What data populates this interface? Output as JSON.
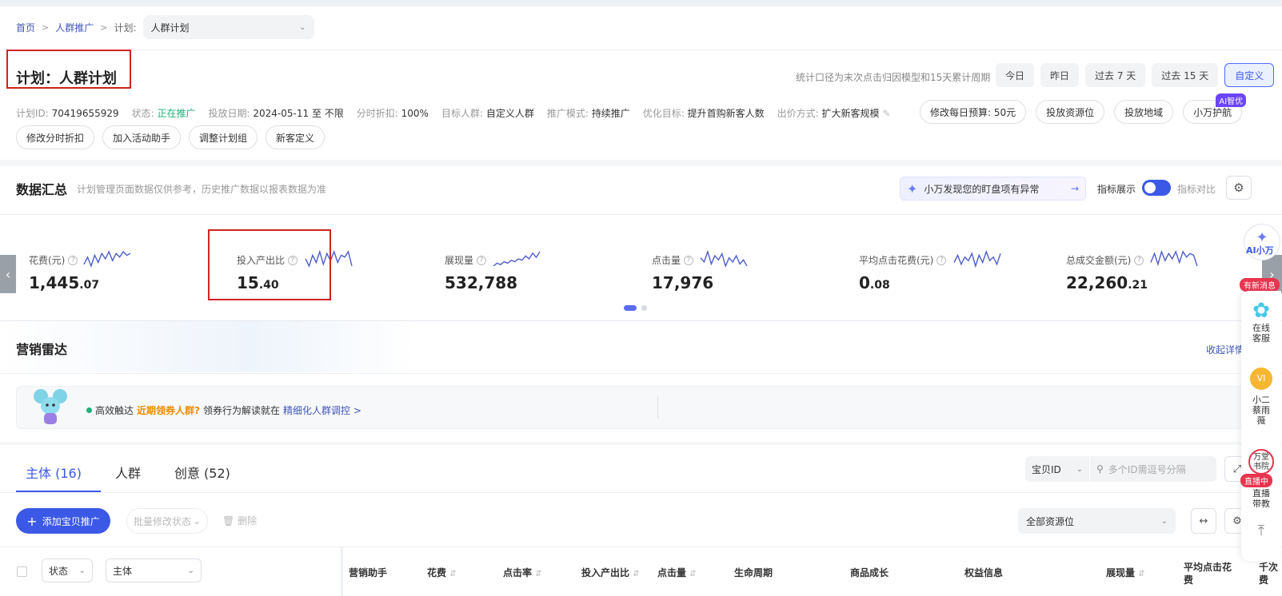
{
  "breadcrumb": {
    "home": "首页",
    "section": "人群推广",
    "plan_label": "计划:",
    "plan_select": "人群计划"
  },
  "title": "计划：人群计划",
  "stat_note": "统计口径为末次点击归因模型和15天累计周期",
  "date_ranges": [
    "今日",
    "昨日",
    "过去 7 天",
    "过去 15 天",
    "自定义"
  ],
  "meta": [
    {
      "k": "计划ID:",
      "v": "70419655929"
    },
    {
      "k": "状态:",
      "v": "正在推广"
    },
    {
      "k": "投放日期:",
      "v": "2024-05-11 至 不限"
    },
    {
      "k": "分时折扣:",
      "v": "100%"
    },
    {
      "k": "目标人群:",
      "v": "自定义人群"
    },
    {
      "k": "推广模式:",
      "v": "持续推广"
    },
    {
      "k": "优化目标:",
      "v": "提升首购新客人数"
    },
    {
      "k": "出价方式:",
      "v": "扩大新客规模"
    }
  ],
  "action_pills": [
    "修改每日预算: 50元",
    "投放资源位",
    "投放地域",
    "小万护航"
  ],
  "ai_badge": "AI智优",
  "action_pills_row2": [
    "修改分时折扣",
    "加入活动助手",
    "调整计划组",
    "新客定义"
  ],
  "summary": {
    "title": "数据汇总",
    "note": "计划管理页面数据仅供参考，历史推广数据以报表数据为准",
    "anomaly": "小万发现您的盯盘项有异常",
    "metric_display": "指标展示",
    "metric_compare": "指标对比"
  },
  "metrics": [
    {
      "label": "花费(元)",
      "int": "1,445",
      "dec": ".07"
    },
    {
      "label": "投入产出比",
      "int": "15",
      "dec": ".40"
    },
    {
      "label": "展现量",
      "int": "532,788",
      "dec": ""
    },
    {
      "label": "点击量",
      "int": "17,976",
      "dec": ""
    },
    {
      "label": "平均点击花费(元)",
      "int": "0",
      "dec": ".08"
    },
    {
      "label": "总成交金额(元)",
      "int": "22,260",
      "dec": ".21"
    }
  ],
  "radar": {
    "title": "营销雷达",
    "collapse": "收起详情",
    "text_a": "高效触达",
    "text_b": "近期领券人群?",
    "text_c": "领券行为解读就在",
    "text_d": "精细化人群调控 >"
  },
  "tabs": [
    "主体 (16)",
    "人群",
    "创意 (52)"
  ],
  "id_select": "宝贝ID",
  "id_search_placeholder": "多个ID需逗号分隔",
  "toolbar": {
    "add": "添加宝贝推广",
    "batch": "批量修改状态",
    "delete": "删除",
    "resource": "全部资源位"
  },
  "table_head": {
    "status": "状态",
    "subject": "主体",
    "assistant": "营销助手",
    "cost": "花费",
    "ctr": "点击率",
    "roi": "投入产出比",
    "clicks": "点击量",
    "lifecycle": "生命周期",
    "growth": "商品成长",
    "benefit": "权益信息",
    "impressions": "展现量",
    "avg_cpc": "平均点击花费",
    "thousand": "千次费"
  },
  "rail": {
    "ai": "AI小万",
    "new_msg": "有新消息",
    "online": "在线客服",
    "xiaoer": "小二蔡雨薇",
    "academy": "万堂书院",
    "live_tag": "直播中",
    "live": "直播带教"
  },
  "sparklines": [
    [
      5,
      9,
      4,
      10,
      6,
      11,
      8,
      12,
      7,
      11,
      9,
      12,
      10,
      11
    ],
    [
      8,
      4,
      10,
      6,
      12,
      5,
      11,
      7,
      12,
      6,
      10,
      9,
      12,
      4
    ],
    [
      3,
      5,
      4,
      6,
      5,
      7,
      6,
      8,
      7,
      10,
      8,
      12,
      9,
      13
    ],
    [
      9,
      7,
      12,
      6,
      10,
      8,
      11,
      5,
      9,
      7,
      10,
      6,
      8,
      5
    ],
    [
      6,
      10,
      5,
      9,
      7,
      11,
      4,
      10,
      6,
      12,
      7,
      9,
      5,
      11
    ],
    [
      6,
      11,
      5,
      12,
      7,
      11,
      8,
      12,
      6,
      12,
      9,
      11,
      10,
      4
    ]
  ],
  "colors": {
    "brand": "#3b58e6",
    "highlight_box": "#d0231e",
    "status_green": "#19b37a",
    "sparkline": "#4e5ec9"
  }
}
